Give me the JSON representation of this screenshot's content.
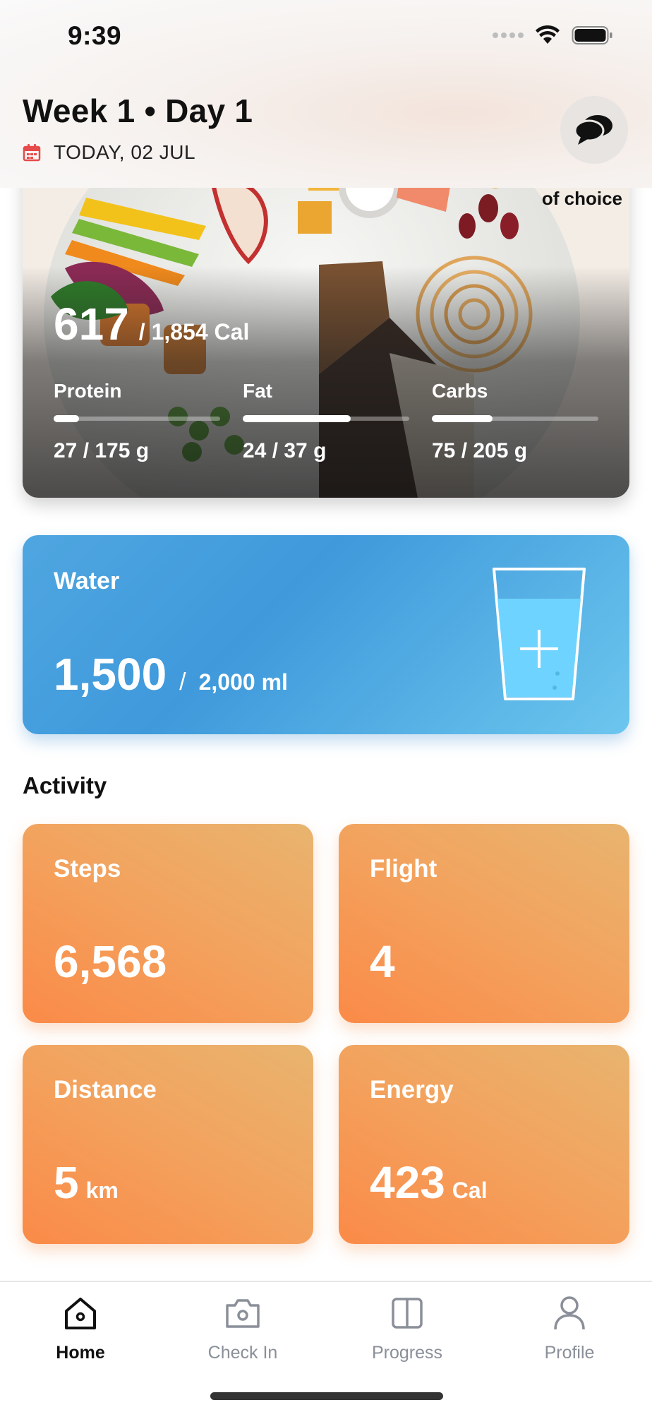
{
  "status_bar": {
    "time": "9:39"
  },
  "header": {
    "title": "Week 1 • Day 1",
    "date": "TODAY, 02 JUL",
    "icons": {
      "calendar": "calendar-icon",
      "chat": "chat-bubbles-icon"
    },
    "calendar_color": "#e64a4a"
  },
  "nutrition": {
    "image_caption": "of choice",
    "calories": {
      "value": "617",
      "total": "/ 1,854 Cal"
    },
    "macros": [
      {
        "label": "Protein",
        "value": "27 / 175 g",
        "progress": 0.154
      },
      {
        "label": "Fat",
        "value": "24 / 37 g",
        "progress": 0.649
      },
      {
        "label": "Carbs",
        "value": "75 / 205 g",
        "progress": 0.366
      }
    ]
  },
  "water": {
    "label": "Water",
    "current": "1,500",
    "separator": "/",
    "goal": "2,000 ml",
    "icon": "add-water-glass-icon",
    "colors": {
      "start": "#3f99db",
      "end": "#6cc6ee"
    }
  },
  "activity": {
    "title": "Activity",
    "cards": [
      {
        "label": "Steps",
        "value": "6,568",
        "unit": ""
      },
      {
        "label": "Flight",
        "value": "4",
        "unit": ""
      },
      {
        "label": "Distance",
        "value": "5",
        "unit": "km"
      },
      {
        "label": "Energy",
        "value": "423",
        "unit": "Cal"
      }
    ],
    "colors": {
      "start": "#fb8a48",
      "end": "#e8b46f"
    }
  },
  "tab_bar": {
    "tabs": [
      {
        "label": "Home",
        "icon": "home-icon",
        "active": true
      },
      {
        "label": "Check In",
        "icon": "camera-icon",
        "active": false
      },
      {
        "label": "Progress",
        "icon": "split-square-icon",
        "active": false
      },
      {
        "label": "Profile",
        "icon": "person-icon",
        "active": false
      }
    ]
  }
}
